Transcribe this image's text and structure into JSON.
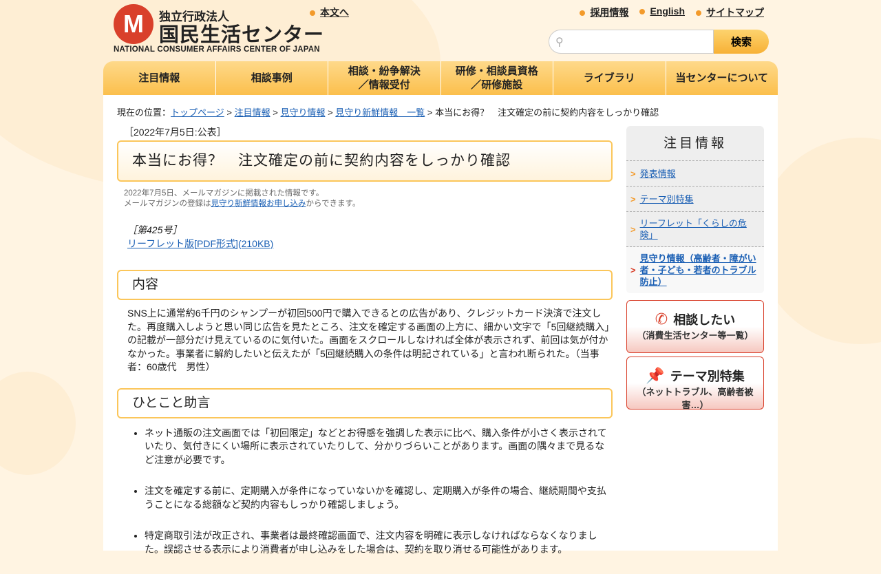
{
  "header": {
    "logo_mark": "M",
    "logo_sub": "独立行政法人",
    "logo_main": "国民生活センター",
    "logo_en": "NATIONAL CONSUMER AFFAIRS CENTER OF JAPAN",
    "skip_link": "本文へ",
    "top_links": [
      "採用情報",
      "English",
      "サイトマップ"
    ],
    "search_placeholder": "",
    "search_button": "検索"
  },
  "nav": [
    "注目情報",
    "相談事例",
    "相談・紛争解決\n／情報受付",
    "研修・相談員資格\n／研修施設",
    "ライブラリ",
    "当センターについて"
  ],
  "breadcrumb": {
    "prefix": "現在の位置：",
    "links": [
      "トップページ",
      "注目情報",
      "見守り情報",
      "見守り新鮮情報　一覧"
    ],
    "current": "本当にお得？　注文確定の前に契約内容をしっかり確認",
    "sep": " > "
  },
  "article": {
    "date": "［2022年7月5日:公表］",
    "title": "本当にお得？　注文確定の前に契約内容をしっかり確認",
    "note1": "2022年7月5日、メールマガジンに掲載された情報です。",
    "note2_pre": "メールマガジンの登録は",
    "note2_link": "見守り新鮮情報お申し込み",
    "note2_post": "からできます。",
    "issue": "［第425号］",
    "leaflet": "リーフレット版[PDF形式](210KB)",
    "h_content": "内容",
    "content": "SNS上に通常約6千円のシャンプーが初回500円で購入できるとの広告があり、クレジットカード決済で注文した。再度購入しようと思い同じ広告を見たところ、注文を確定する画面の上方に、細かい文字で「5回継続購入」の記載が一部分だけ見えているのに気付いた。画面をスクロールしなければ全体が表示されず、前回は気が付かなかった。事業者に解約したいと伝えたが「5回継続購入の条件は明記されている」と言われ断られた。（当事者：60歳代　男性）",
    "h_advice": "ひとこと助言",
    "advice": [
      "ネット通販の注文画面では「初回限定」などとお得感を強調した表示に比べ、購入条件が小さく表示されていたり、気付きにくい場所に表示されていたりして、分かりづらいことがあります。画面の隅々まで見るなど注意が必要です。",
      "注文を確定する前に、定期購入が条件になっていないかを確認し、定期購入が条件の場合、継続期間や支払うことになる総額など契約内容もしっかり確認しましょう。",
      "特定商取引法が改正され、事業者は最終確認画面で、注文内容を明確に表示しなければならなくなりました。誤認させる表示により消費者が申し込みをした場合は、契約を取り消せる可能性があります。"
    ]
  },
  "sidebar": {
    "title": "注目情報",
    "items": [
      "発表情報",
      "テーマ別特集",
      "リーフレット「くらしの危険」",
      "見守り情報（高齢者・障がい者・子ども・若者のトラブル防止）"
    ],
    "banner1_title": "相談したい",
    "banner1_sub": "（消費生活センター等一覧）",
    "banner2_title": "テーマ別特集",
    "banner2_sub": "（ネットトラブル、高齢者被害…）"
  }
}
